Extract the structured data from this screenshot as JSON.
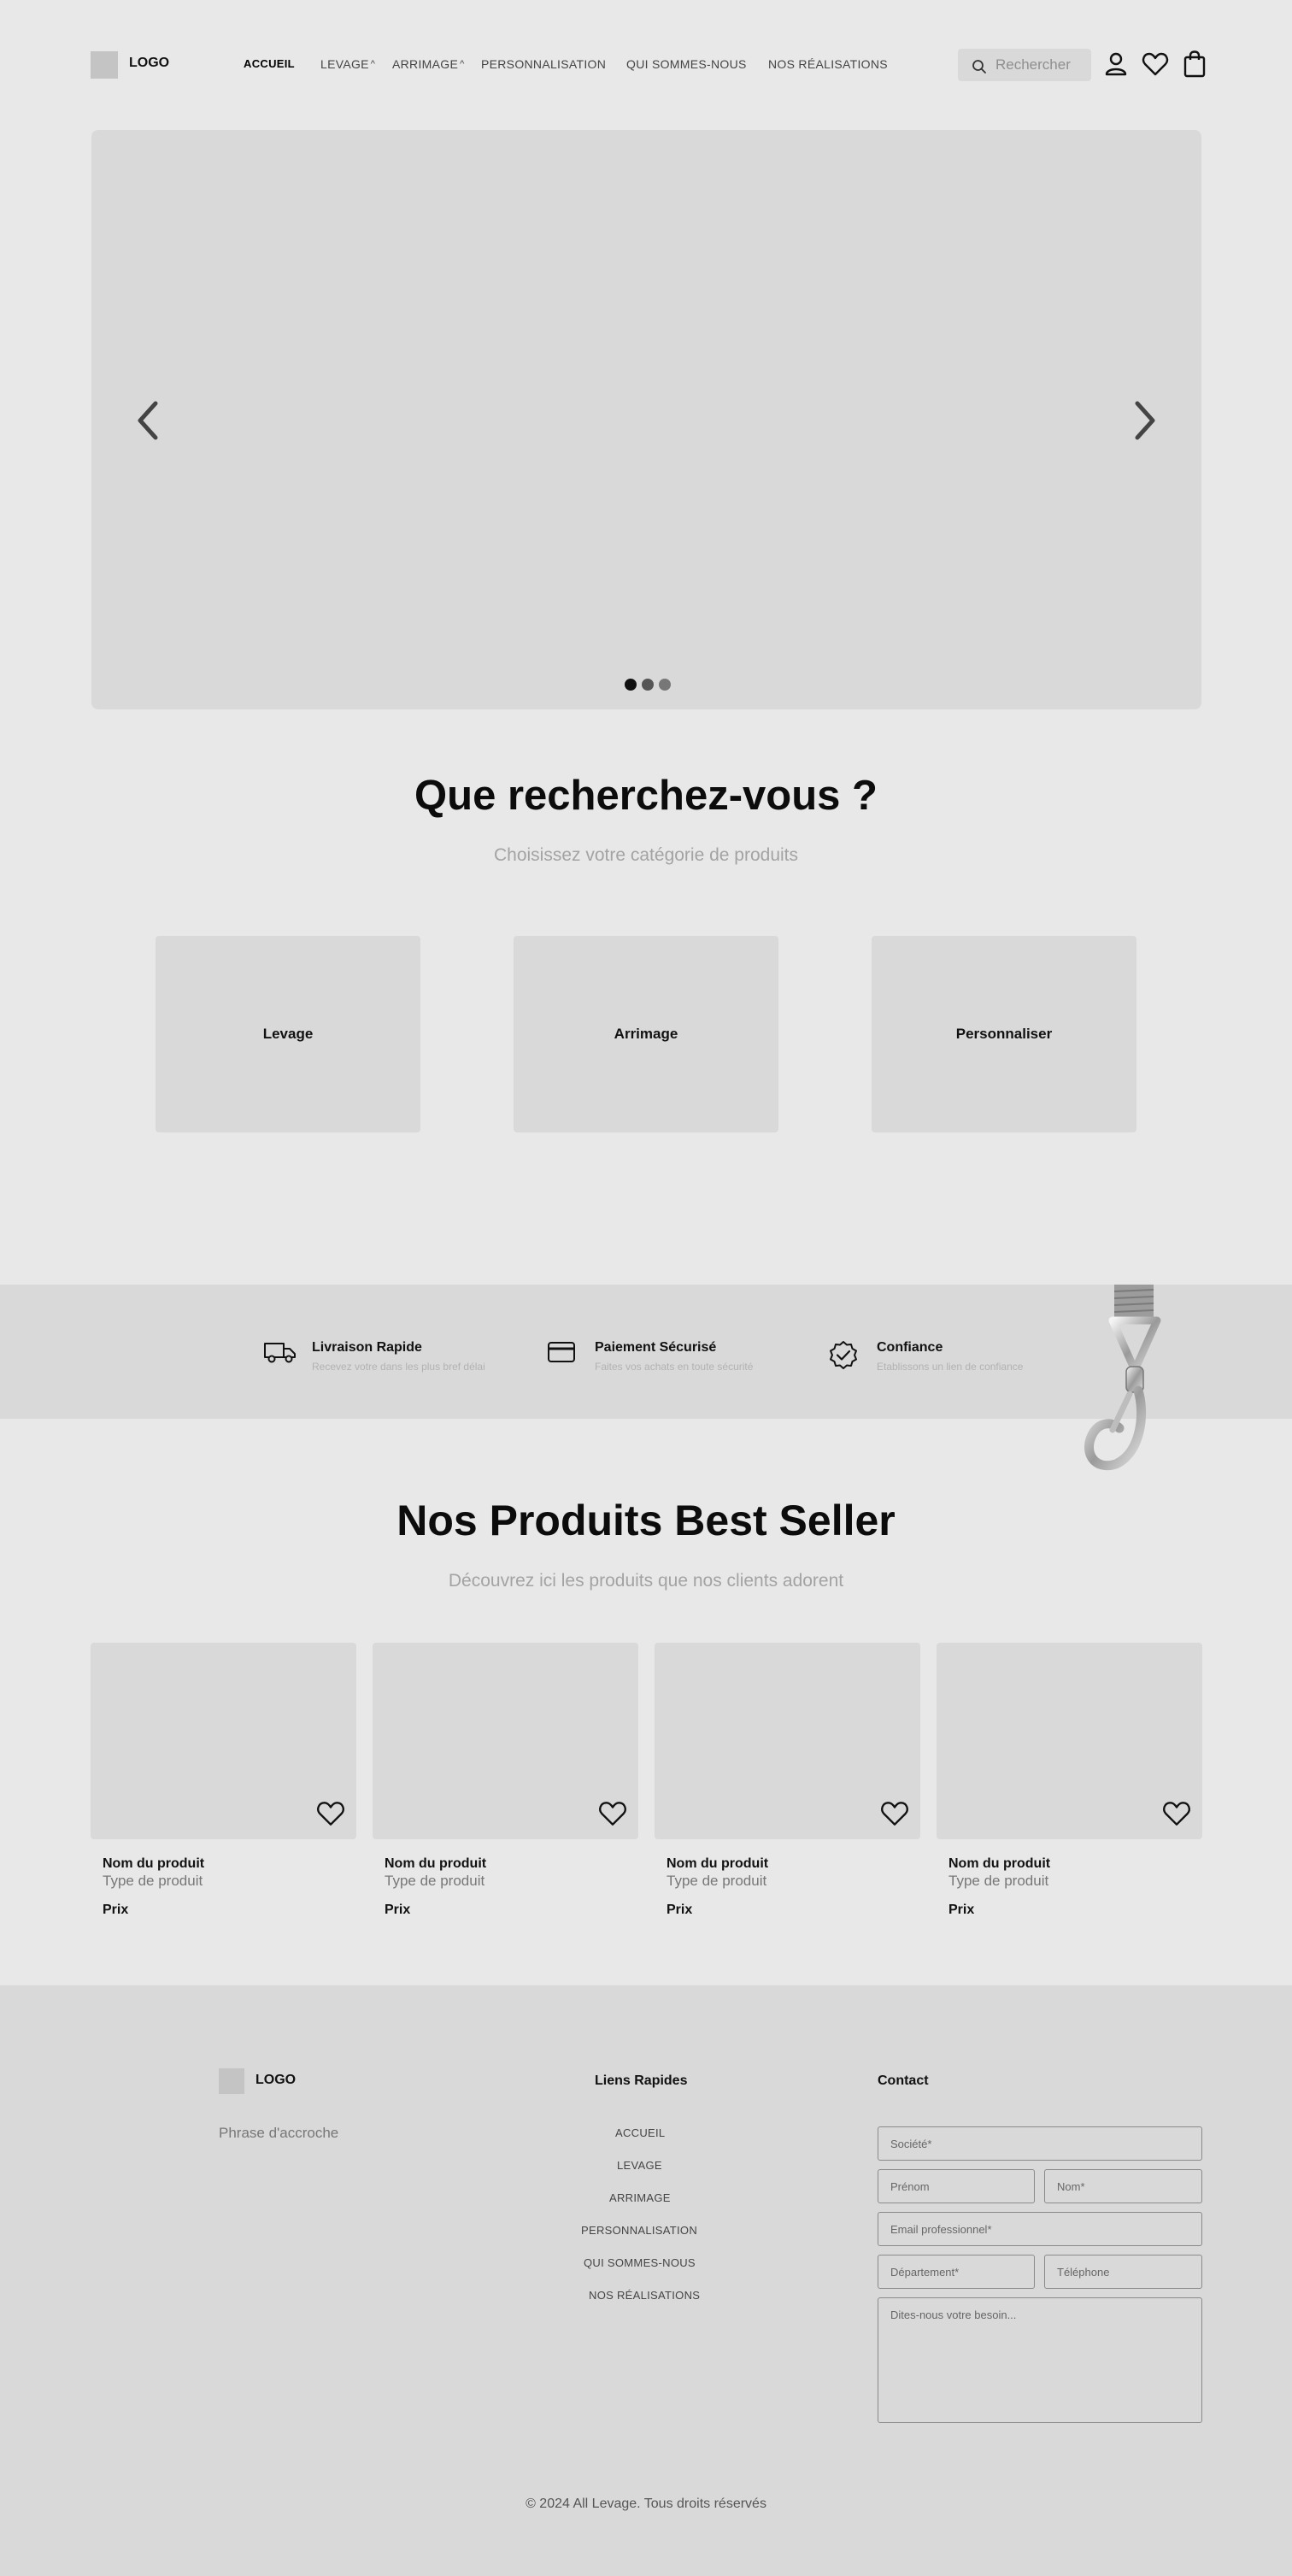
{
  "header": {
    "logo_text": "LOGO",
    "nav": [
      {
        "label": "ACCUEIL",
        "has_dropdown": false,
        "active": true
      },
      {
        "label": "LEVAGE",
        "has_dropdown": true,
        "active": false
      },
      {
        "label": "ARRIMAGE",
        "has_dropdown": true,
        "active": false
      },
      {
        "label": "PERSONNALISATION",
        "has_dropdown": false,
        "active": false
      },
      {
        "label": "QUI SOMMES-NOUS",
        "has_dropdown": false,
        "active": false
      },
      {
        "label": "NOS RÉALISATIONS",
        "has_dropdown": false,
        "active": false
      }
    ],
    "dropdown_caret": "^",
    "search_placeholder": "Rechercher",
    "icons": [
      "search-icon",
      "user-icon",
      "heart-icon",
      "shopping-bag-icon"
    ]
  },
  "hero": {
    "carousel_slides": 3,
    "active_slide": 1,
    "icons": [
      "chevron-left-icon",
      "chevron-right-icon"
    ]
  },
  "categories": {
    "title": "Que recherchez-vous ?",
    "subtitle": "Choisissez votre catégorie de produits",
    "items": [
      "Levage",
      "Arrimage",
      "Personnaliser"
    ]
  },
  "features": [
    {
      "icon": "truck-icon",
      "title": "Livraison Rapide",
      "subtitle": "Recevez votre dans les plus bref délai"
    },
    {
      "icon": "credit-card-icon",
      "title": "Paiement Sécurisé",
      "subtitle": "Faites vos achats en toute sécurité"
    },
    {
      "icon": "badge-check-icon",
      "title": "Confiance",
      "subtitle": "Etablissons un lien de confiance"
    }
  ],
  "best_sellers": {
    "title": "Nos Produits Best Seller",
    "subtitle": "Découvrez ici les produits que nos clients adorent",
    "products": [
      {
        "name": "Nom du produit",
        "type": "Type de produit",
        "price": "Prix"
      },
      {
        "name": "Nom du produit",
        "type": "Type de produit",
        "price": "Prix"
      },
      {
        "name": "Nom du produit",
        "type": "Type de produit",
        "price": "Prix"
      },
      {
        "name": "Nom du produit",
        "type": "Type de produit",
        "price": "Prix"
      }
    ]
  },
  "footer": {
    "logo_text": "LOGO",
    "tagline": "Phrase d'accroche",
    "links_title": "Liens Rapides",
    "links": [
      "ACCUEIL",
      "LEVAGE",
      "ARRIMAGE",
      "PERSONNALISATION",
      "QUI SOMMES-NOUS",
      "NOS RÉALISATIONS"
    ],
    "contact_title": "Contact",
    "form": {
      "company": "Société*",
      "first_name": "Prénom",
      "last_name": "Nom*",
      "email": "Email professionnel*",
      "department": "Département*",
      "phone": "Téléphone",
      "message": "Dites-nous votre besoin..."
    },
    "copyright": "© 2024 All Levage. Tous droits réservés"
  },
  "colors": {
    "page_bg": "#e8e8e8",
    "panel": "#d9d9d9",
    "logo_placeholder": "#c4c4c4",
    "muted_text": "#a3a3a3"
  }
}
